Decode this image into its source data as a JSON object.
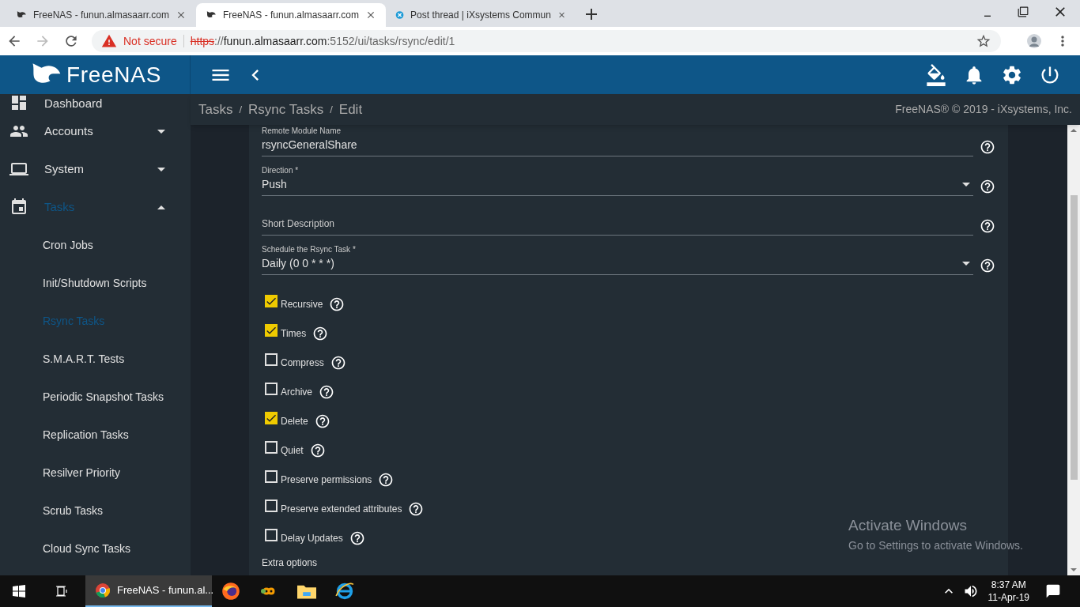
{
  "browser": {
    "tabs": [
      {
        "title": "FreeNAS - funun.almasaarr.com",
        "selected": false
      },
      {
        "title": "FreeNAS - funun.almasaarr.com",
        "selected": true
      },
      {
        "title": "Post thread | iXsystems Commun",
        "selected": false
      }
    ],
    "security": "Not secure",
    "url": [
      {
        "text": "https",
        "kind": "struck"
      },
      {
        "text": "://",
        "kind": "dim"
      },
      {
        "text": "funun.almasaarr.com",
        "kind": "host"
      },
      {
        "text": ":5152/ui/tasks/rsync/edit/1",
        "kind": "dim"
      }
    ]
  },
  "app": {
    "logo": "FreeNAS",
    "copyright": "FreeNAS® © 2019 - iXsystems, Inc.",
    "breadcrumbs": [
      "Tasks",
      "Rsync Tasks",
      "Edit"
    ],
    "separator": "/"
  },
  "sidebar": {
    "items": [
      {
        "label": "Dashboard",
        "selected": false
      },
      {
        "label": "Accounts",
        "expanded": false,
        "selected": false
      },
      {
        "label": "System",
        "expanded": false,
        "selected": false
      },
      {
        "label": "Tasks",
        "expanded": true,
        "selected": true,
        "children": [
          {
            "label": "Cron Jobs",
            "selected": false
          },
          {
            "label": "Init/Shutdown Scripts",
            "selected": false
          },
          {
            "label": "Rsync Tasks",
            "selected": true
          },
          {
            "label": "S.M.A.R.T. Tests",
            "selected": false
          },
          {
            "label": "Periodic Snapshot Tasks",
            "selected": false
          },
          {
            "label": "Replication Tasks",
            "selected": false
          },
          {
            "label": "Resilver Priority",
            "selected": false
          },
          {
            "label": "Scrub Tasks",
            "selected": false
          },
          {
            "label": "Cloud Sync Tasks",
            "selected": false
          }
        ]
      }
    ]
  },
  "form": {
    "fields": [
      {
        "kind": "text",
        "label": "Remote Module Name",
        "value": "rsyncGeneralShare"
      },
      {
        "kind": "select",
        "label": "Direction *",
        "value": "Push"
      },
      {
        "kind": "text",
        "placeholder": "Short Description"
      },
      {
        "kind": "select",
        "label": "Schedule the Rsync Task *",
        "value": "Daily (0 0 * * *)"
      }
    ],
    "checkboxes": [
      {
        "label": "Recursive",
        "checked": true
      },
      {
        "label": "Times",
        "checked": true
      },
      {
        "label": "Compress",
        "checked": false
      },
      {
        "label": "Archive",
        "checked": false
      },
      {
        "label": "Delete",
        "checked": true
      },
      {
        "label": "Quiet",
        "checked": false
      },
      {
        "label": "Preserve permissions",
        "checked": false
      },
      {
        "label": "Preserve extended attributes",
        "checked": false
      },
      {
        "label": "Delay Updates",
        "checked": false
      }
    ],
    "section": "Extra options"
  },
  "activation": {
    "title": "Activate Windows",
    "text": "Go to Settings to activate Windows."
  },
  "taskbar": {
    "app": "FreeNAS - funun.al...",
    "time": "8:37 AM",
    "date": "11-Apr-19"
  }
}
